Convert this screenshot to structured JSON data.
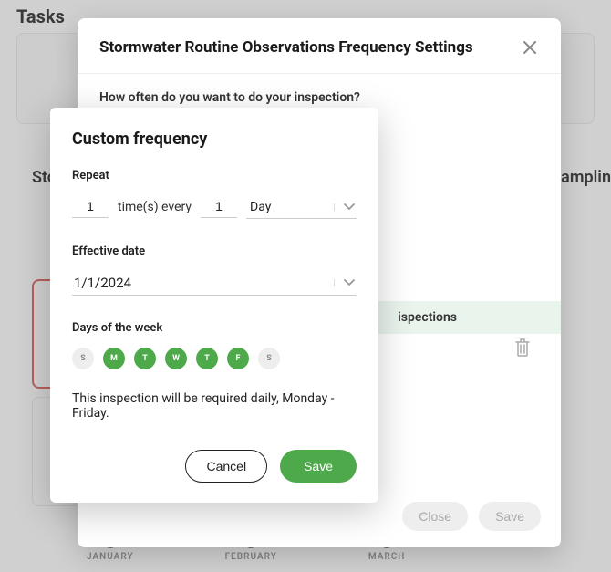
{
  "background": {
    "tasks_heading": "Tasks",
    "left_heading": "Sto",
    "right_heading": "Samplin",
    "months": [
      "JANUARY",
      "FEBRUARY",
      "MARCH"
    ]
  },
  "outer": {
    "title": "Stormwater Routine Observations Frequency Settings",
    "prompt": "How often do you want to do your inspection?",
    "inspections_label": "ispections",
    "footer": {
      "close": "Close",
      "save": "Save"
    }
  },
  "inner": {
    "title": "Custom frequency",
    "repeat": {
      "label": "Repeat",
      "count": "1",
      "times_text": "time(s) every",
      "interval": "1",
      "unit": "Day"
    },
    "effective": {
      "label": "Effective date",
      "value": "1/1/2024"
    },
    "days": {
      "label": "Days of the week",
      "items": [
        {
          "short": "S",
          "selected": false
        },
        {
          "short": "M",
          "selected": true
        },
        {
          "short": "T",
          "selected": true
        },
        {
          "short": "W",
          "selected": true
        },
        {
          "short": "T",
          "selected": true
        },
        {
          "short": "F",
          "selected": true
        },
        {
          "short": "S",
          "selected": false
        }
      ]
    },
    "summary": "This inspection will be required daily, Monday - Friday.",
    "footer": {
      "cancel": "Cancel",
      "save": "Save"
    }
  },
  "colors": {
    "accent": "#4ea94b",
    "danger": "#d9534f"
  }
}
